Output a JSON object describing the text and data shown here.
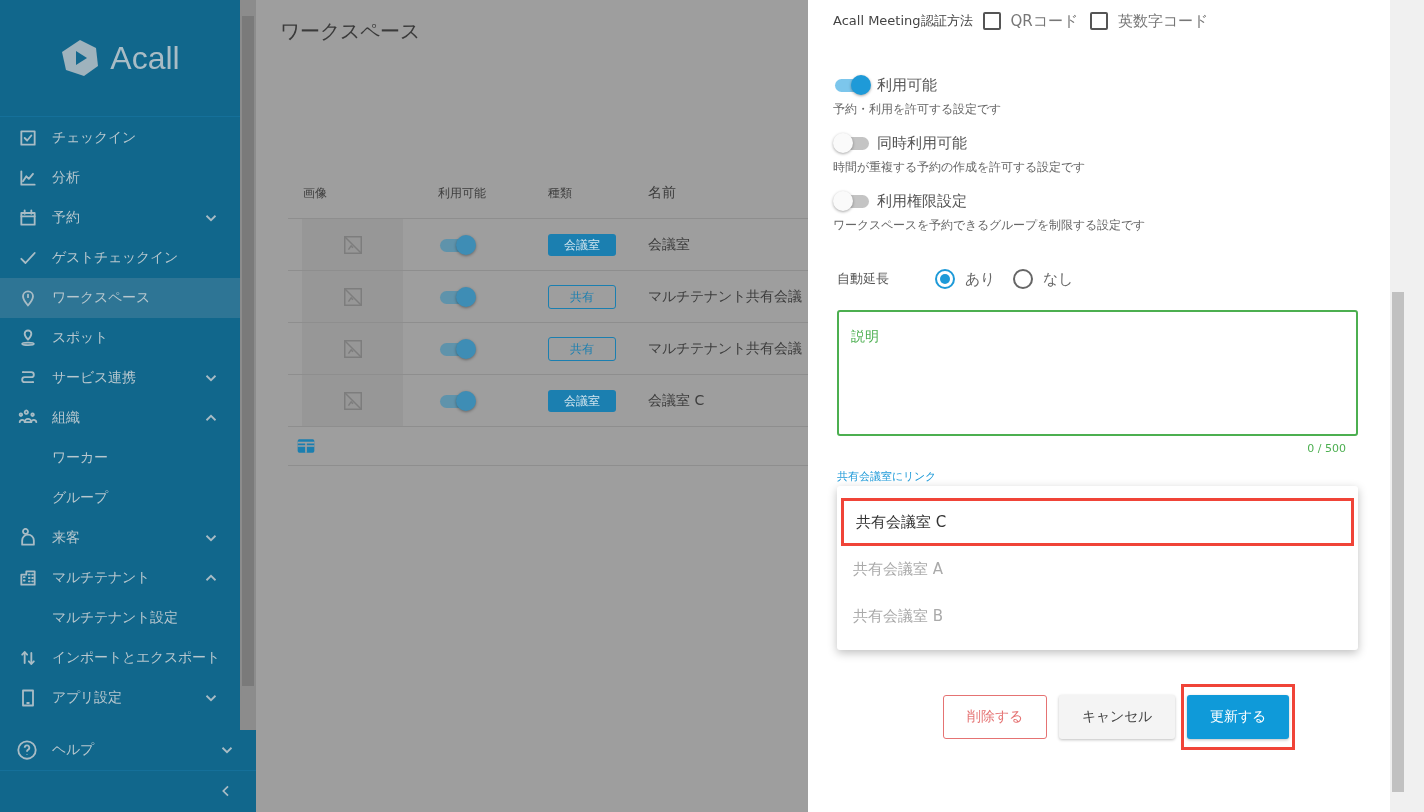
{
  "sidebar": {
    "logo_text": "Acall",
    "items": [
      {
        "label": "チェックイン",
        "selected": false
      },
      {
        "label": "分析",
        "selected": false
      },
      {
        "label": "予約",
        "selected": false,
        "expanded": false
      },
      {
        "label": "ゲストチェックイン",
        "selected": false
      },
      {
        "label": "ワークスペース",
        "selected": true
      },
      {
        "label": "スポット",
        "selected": false
      },
      {
        "label": "サービス連携",
        "selected": false,
        "expanded": false
      },
      {
        "label": "組織",
        "selected": false,
        "expanded": true,
        "children": [
          {
            "label": "ワーカー",
            "selected": false
          },
          {
            "label": "グループ",
            "selected": false
          }
        ]
      },
      {
        "label": "来客",
        "selected": false,
        "expanded": false
      },
      {
        "label": "マルチテナント",
        "selected": false,
        "expanded": true,
        "children": [
          {
            "label": "マルチテナント設定",
            "selected": false
          }
        ]
      },
      {
        "label": "インポートとエクスポート",
        "selected": false
      },
      {
        "label": "アプリ設定",
        "selected": false,
        "expanded": false
      }
    ],
    "help": {
      "label": "ヘルプ",
      "expanded": false
    }
  },
  "page": {
    "title": "ワークスペース",
    "table": {
      "columns": [
        "画像",
        "利用可能",
        "種類",
        "名前"
      ],
      "rows": [
        {
          "available": true,
          "type": {
            "label": "会議室",
            "kind": "filled"
          },
          "name": "会議室"
        },
        {
          "available": true,
          "type": {
            "label": "共有",
            "kind": "outline"
          },
          "name": "マルチテナント共有会議"
        },
        {
          "available": true,
          "type": {
            "label": "共有",
            "kind": "outline"
          },
          "name": "マルチテナント共有会議"
        },
        {
          "available": true,
          "type": {
            "label": "会議室",
            "kind": "filled"
          },
          "name": "会議室 C"
        }
      ]
    }
  },
  "dialog": {
    "auth": {
      "label": "Acall Meeting認証方法",
      "options": [
        {
          "label": "QRコード",
          "checked": false
        },
        {
          "label": "英数字コード",
          "checked": false
        }
      ]
    },
    "switches": [
      {
        "label": "利用可能",
        "on": true,
        "description": "予約・利用を許可する設定です"
      },
      {
        "label": "同時利用可能",
        "on": false,
        "description": "時間が重複する予約の作成を許可する設定です"
      },
      {
        "label": "利用権限設定",
        "on": false,
        "description": "ワークスペースを予約できるグループを制限する設定です"
      }
    ],
    "auto_extend": {
      "label": "自動延長",
      "options": [
        {
          "label": "あり",
          "selected": true
        },
        {
          "label": "なし",
          "selected": false
        }
      ]
    },
    "description": {
      "label": "説明",
      "counter": "0 / 500"
    },
    "link_select": {
      "label": "共有会議室にリンク",
      "options": [
        {
          "label": "共有会議室 C",
          "selected": true,
          "highlighted": true
        },
        {
          "label": "共有会議室 A",
          "selected": false,
          "highlighted": false
        },
        {
          "label": "共有会議室 B",
          "selected": false,
          "highlighted": false
        }
      ]
    },
    "buttons": [
      {
        "label": "削除する",
        "kind": "danger",
        "highlighted": false
      },
      {
        "label": "キャンセル",
        "kind": "plain",
        "highlighted": false
      },
      {
        "label": "更新する",
        "kind": "primary",
        "highlighted": true
      }
    ]
  }
}
